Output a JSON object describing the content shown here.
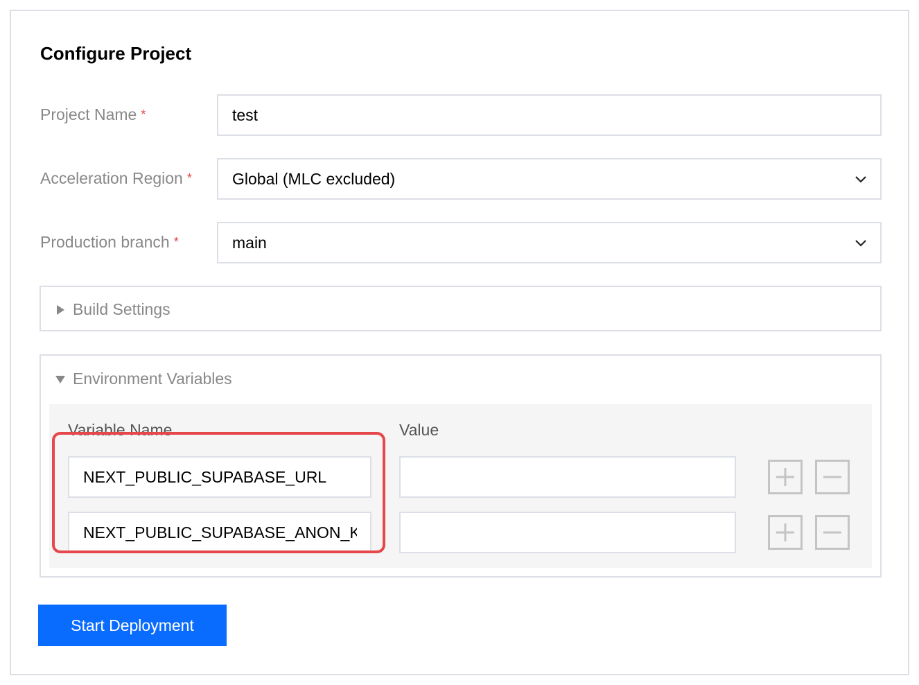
{
  "title": "Configure Project",
  "fields": {
    "project_name": {
      "label": "Project Name",
      "required_mark": "*",
      "value": "test"
    },
    "acceleration_region": {
      "label": "Acceleration Region",
      "required_mark": "*",
      "value": "Global (MLC excluded)"
    },
    "production_branch": {
      "label": "Production branch",
      "required_mark": "*",
      "value": "main"
    }
  },
  "build_settings": {
    "label": "Build Settings",
    "expanded": false
  },
  "env_vars": {
    "label": "Environment Variables",
    "expanded": true,
    "columns": {
      "name": "Variable Name",
      "value": "Value"
    },
    "rows": [
      {
        "name": "NEXT_PUBLIC_SUPABASE_URL",
        "value": ""
      },
      {
        "name": "NEXT_PUBLIC_SUPABASE_ANON_KEY",
        "value": ""
      }
    ]
  },
  "actions": {
    "start_deployment": "Start Deployment"
  },
  "colors": {
    "accent": "#0a6cff",
    "highlight": "#e5474b",
    "required": "#e54545"
  },
  "icons": [
    "chevron-down-icon",
    "triangle-right-icon",
    "triangle-down-icon",
    "plus-icon",
    "minus-icon"
  ]
}
